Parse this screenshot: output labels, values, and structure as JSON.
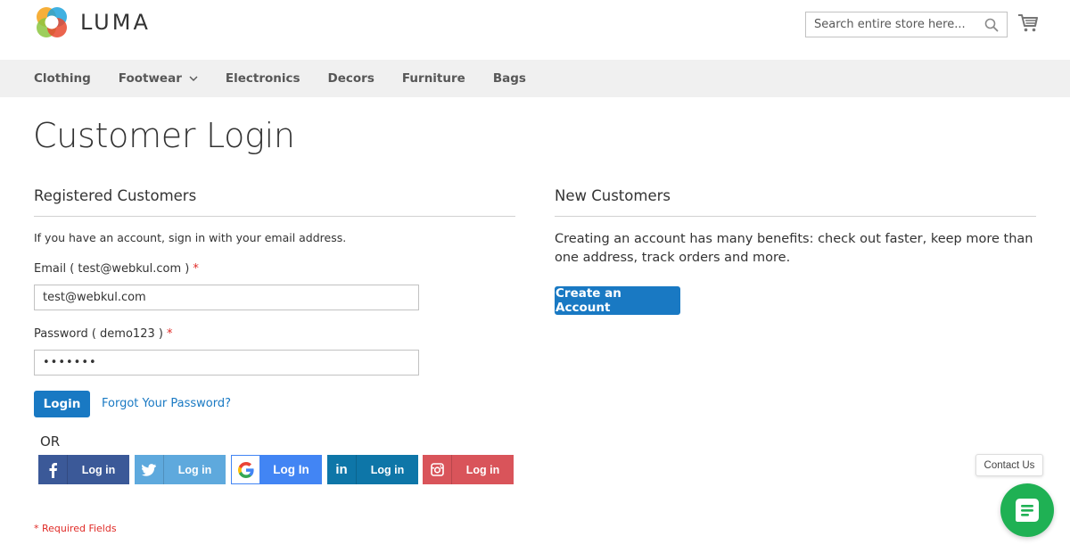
{
  "header": {
    "logo_text": "LUMA",
    "search_placeholder": "Search entire store here..."
  },
  "nav": {
    "items": [
      "Clothing",
      "Footwear",
      "Electronics",
      "Decors",
      "Furniture",
      "Bags"
    ]
  },
  "page_title": "Customer Login",
  "registered": {
    "title": "Registered Customers",
    "intro": "If you have an account, sign in with your email address.",
    "email_label": "Email ( test@webkul.com )",
    "email_value": "test@webkul.com",
    "password_label": "Password ( demo123 )",
    "password_value": "•••••••",
    "required_mark": "*",
    "login_button": "Login",
    "forgot_link": "Forgot Your Password?",
    "or_text": "OR",
    "social": [
      {
        "name": "facebook",
        "label": "Log in",
        "color": "#3b5998",
        "icon": "facebook-icon"
      },
      {
        "name": "twitter",
        "label": "Log in",
        "color": "#5ea9dd",
        "icon": "twitter-icon"
      },
      {
        "name": "google",
        "label": "Log In",
        "color": "#4285f4",
        "icon": "google-icon"
      },
      {
        "name": "linkedin",
        "label": "Log in",
        "color": "#0e76a8",
        "icon": "linkedin-icon"
      },
      {
        "name": "instagram",
        "label": "Log in",
        "color": "#d9545a",
        "icon": "instagram-icon"
      }
    ],
    "required_note": "* Required Fields"
  },
  "new_customers": {
    "title": "New Customers",
    "text": "Creating an account has many benefits: check out faster, keep more than one address, track orders and more.",
    "create_button": "Create an Account"
  },
  "contact": {
    "tooltip": "Contact Us"
  },
  "colors": {
    "primary": "#1979c3",
    "required": "#e02b27",
    "chat": "#1fb154",
    "nav_bg": "#f0f0f0"
  }
}
